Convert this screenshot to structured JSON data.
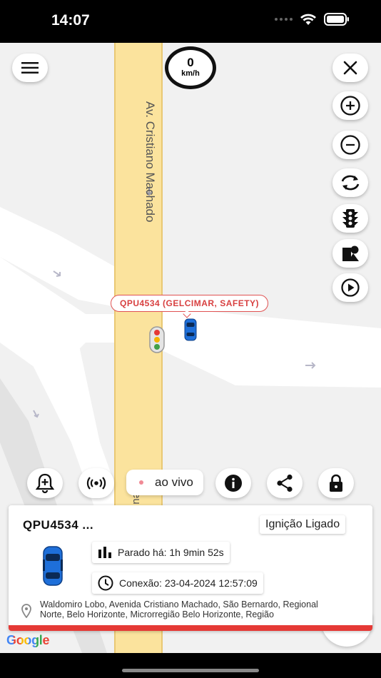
{
  "status_bar": {
    "time": "14:07",
    "icons": [
      "signal-dots-icon",
      "wifi-icon",
      "battery-icon"
    ]
  },
  "map": {
    "street_name": "Av. Cristiano Machado",
    "street_name_partial": "eu",
    "speed": {
      "value": "0",
      "unit": "km/h"
    },
    "vehicle_label": "QPU4534 (GELCIMAR, SAFETY)",
    "attribution": "Google",
    "controls": [
      "menu-icon",
      "close-icon",
      "zoom-in-icon",
      "zoom-out-icon",
      "refresh-icon",
      "traffic-icon",
      "layers-icon",
      "play-icon"
    ]
  },
  "action_bar": {
    "live_label": "ao vivo",
    "buttons": [
      "bell-plus-icon",
      "broadcast-icon",
      "info-icon",
      "share-icon",
      "lock-icon"
    ]
  },
  "vehicle_card": {
    "plate": "QPU4534 ...",
    "ignition": "Ignição Ligado",
    "stopped": "Parado há: 1h 9min 52s",
    "connection": "Conexão: 23-04-2024 12:57:09",
    "address_line1": "Waldomiro Lobo, Avenida Cristiano Machado, São Bernardo, Regional",
    "address_line2": "Norte, Belo Horizonte, Microrregião Belo Horizonte, Região"
  },
  "colors": {
    "accent_red": "#e53935",
    "road_yellow": "#fbe39d",
    "car_blue": "#1e6fd9"
  }
}
